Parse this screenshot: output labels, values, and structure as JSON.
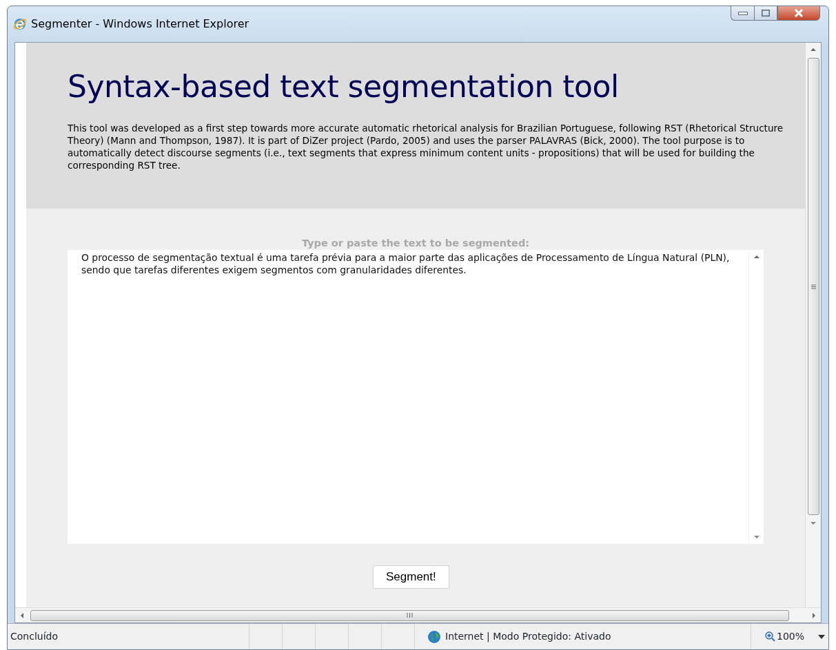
{
  "window": {
    "title": "Segmenter - Windows Internet Explorer"
  },
  "page": {
    "heading": "Syntax-based text segmentation tool",
    "intro": "This tool was developed as a first step towards more accurate automatic rhetorical analysis for Brazilian Portuguese, following RST (Rhetorical Structure Theory) (Mann and Thompson, 1987). It is part of DiZer project (Pardo, 2005) and uses the parser PALAVRAS (Bick, 2000). The tool purpose is to automatically detect discourse segments (i.e., text segments that express minimum content units - propositions) that will be used for building the corresponding RST tree.",
    "prompt": "Type or paste the text to be segmented:",
    "text": "O processo de segmentação textual é uma tarefa prévia para a maior parte das aplicações de Processamento de Língua Natural (PLN), sendo que tarefas diferentes exigem segmentos com granularidades diferentes.",
    "button": "Segment!"
  },
  "status_bar": {
    "status": "Concluído",
    "zone": "Internet | Modo Protegido: Ativado",
    "zoom": "100%"
  }
}
